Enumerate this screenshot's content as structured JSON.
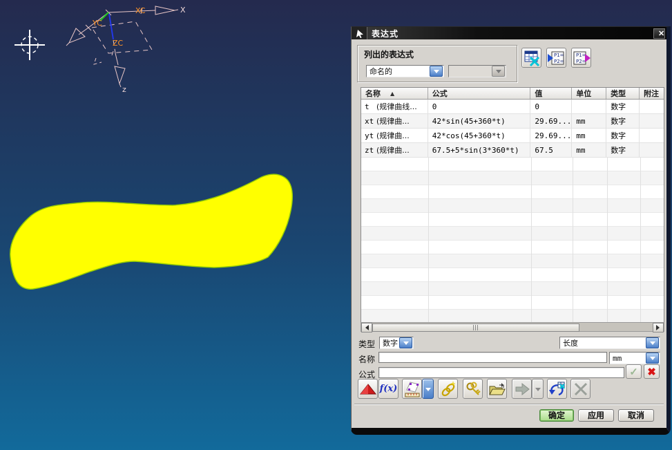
{
  "viewport": {
    "triad": {
      "xc": "XC",
      "yc": "YC",
      "zc": "ZC",
      "x": "X",
      "z": "z"
    },
    "blob_color": "#ffff00",
    "bg_top": "#242a4e",
    "bg_bottom": "#126a9b"
  },
  "dialog": {
    "title": "表达式",
    "icons": {
      "close": "✕",
      "fx": "f(x)",
      "p1": "P1=",
      "p2": "P2=",
      "sort": "▲"
    },
    "listed": {
      "label": "列出的表达式",
      "filter_value": "命名的"
    },
    "table": {
      "columns": [
        "名称",
        "公式",
        "值",
        "单位",
        "类型",
        "附注"
      ],
      "rows": [
        {
          "name": "t",
          "desc": "(规律曲线...",
          "formula": "0",
          "value": "0",
          "unit": "",
          "type": "数字",
          "note": ""
        },
        {
          "name": "xt",
          "desc": "(规律曲...",
          "formula": "42*sin(45+360*t)",
          "value": "29.69...",
          "unit": "mm",
          "type": "数字",
          "note": ""
        },
        {
          "name": "yt",
          "desc": "(规律曲...",
          "formula": "42*cos(45+360*t)",
          "value": "29.69...",
          "unit": "mm",
          "type": "数字",
          "note": ""
        },
        {
          "name": "zt",
          "desc": "(规律曲...",
          "formula": "67.5+5*sin(3*360*t)",
          "value": "67.5",
          "unit": "mm",
          "type": "数字",
          "note": ""
        }
      ]
    },
    "footer": {
      "type_label": "类型",
      "type_value": "数字",
      "dimension_value": "长度",
      "name_label": "名称",
      "name_value": "",
      "unit_value": "mm",
      "formula_label": "公式",
      "formula_value": ""
    },
    "buttons": {
      "ok": "确定",
      "apply": "应用",
      "cancel": "取消"
    }
  }
}
